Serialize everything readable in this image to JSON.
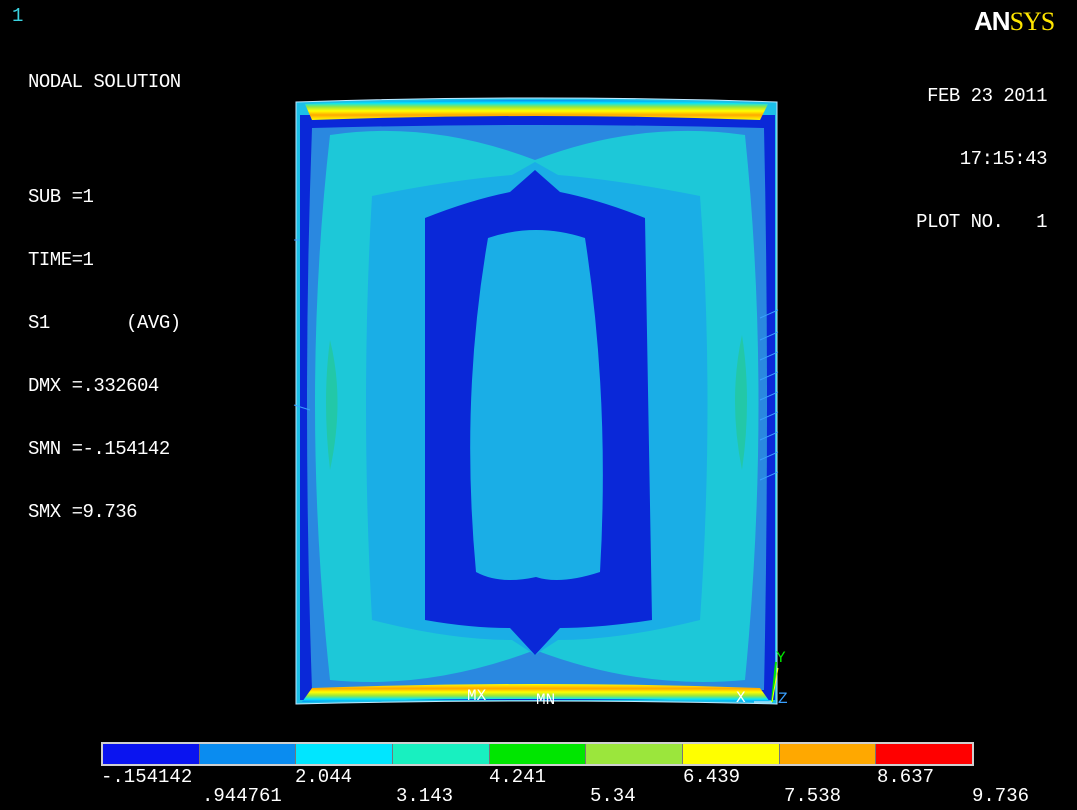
{
  "window": {
    "number": "1"
  },
  "logo": {
    "part1": "AN",
    "part2": "SYS"
  },
  "info_lines": {
    "title": "NODAL SOLUTION",
    "sub": "SUB =1",
    "time": "TIME=1",
    "s1": "S1       (AVG)",
    "dmx": "DMX =.332604",
    "smn": "SMN =-.154142",
    "smx": "SMX =9.736"
  },
  "stamp": {
    "date": "FEB 23 2011",
    "time": "17:15:43",
    "plot": "PLOT NO.   1"
  },
  "triad": {
    "x": "X",
    "y": "Y",
    "z": "Z"
  },
  "markers": {
    "mx": "MX",
    "mn": "MN"
  },
  "colors": {
    "c1": "#0a14f0",
    "c2": "#0a8cf0",
    "c3": "#00e6ff",
    "c4": "#18f0c0",
    "c5": "#00e600",
    "c6": "#9be63c",
    "c7": "#ffff00",
    "c8": "#ffa800",
    "c9": "#ff0000",
    "deep": "#0a28d8",
    "mid": "#2a88e0",
    "pale": "#1cbfe8",
    "teal": "#28c8c0"
  },
  "legend": {
    "swatches": [
      "#0a14f0",
      "#0a8cf0",
      "#00e6ff",
      "#18f0c0",
      "#00e600",
      "#9be63c",
      "#ffff00",
      "#ffa800",
      "#ff0000"
    ],
    "upper": [
      "-.154142",
      "2.044",
      "4.241",
      "6.439",
      "8.637"
    ],
    "lower": [
      ".944761",
      "3.143",
      "5.34",
      "7.538",
      "9.736"
    ]
  }
}
